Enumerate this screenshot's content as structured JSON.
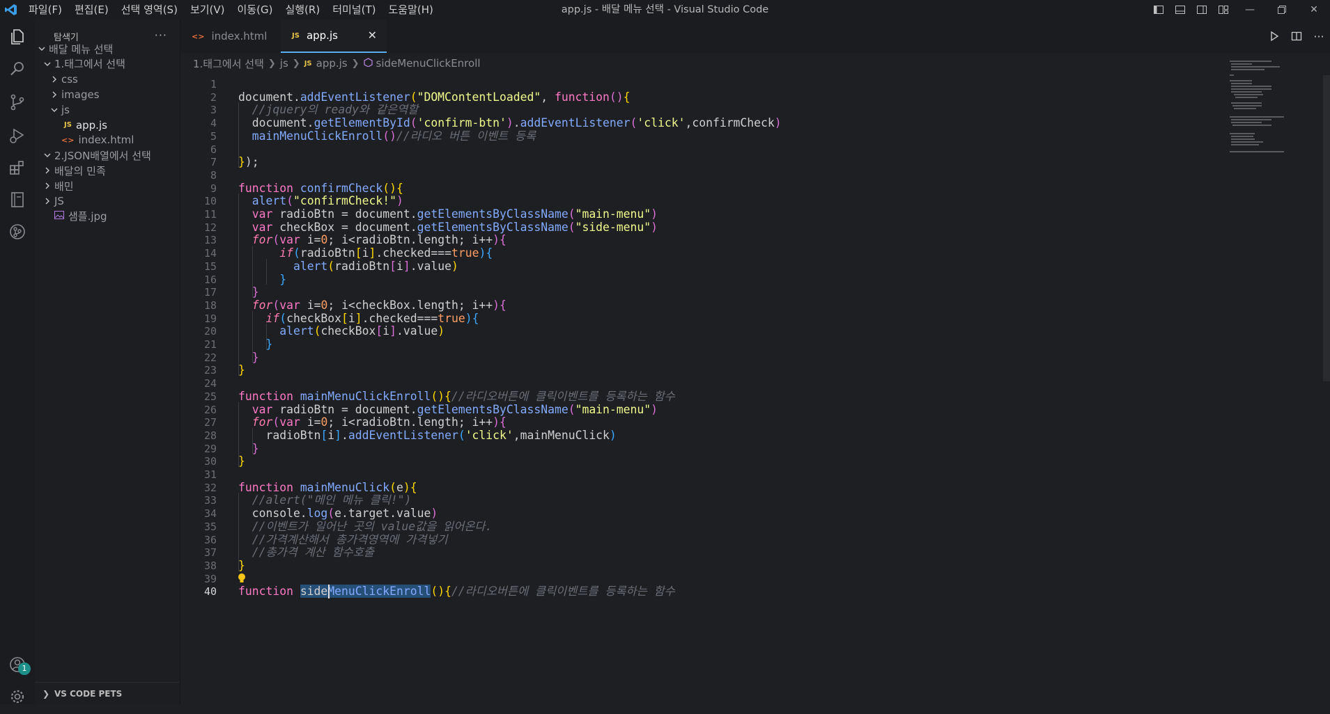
{
  "window": {
    "title": "app.js - 배달 메뉴 선택 - Visual Studio Code"
  },
  "menu": [
    "파일(F)",
    "편집(E)",
    "선택 영역(S)",
    "보기(V)",
    "이동(G)",
    "실행(R)",
    "터미널(T)",
    "도움말(H)"
  ],
  "activity": {
    "badge": "1"
  },
  "sidebar": {
    "title": "탐색기",
    "tree": [
      {
        "label": "배달 메뉴 선택",
        "depth": 0,
        "chevron": "down",
        "icon": ""
      },
      {
        "label": "1.태그에서 선택",
        "depth": 1,
        "chevron": "down",
        "icon": ""
      },
      {
        "label": "css",
        "depth": 2,
        "chevron": "right",
        "icon": ""
      },
      {
        "label": "images",
        "depth": 2,
        "chevron": "right",
        "icon": ""
      },
      {
        "label": "js",
        "depth": 2,
        "chevron": "down",
        "icon": ""
      },
      {
        "label": "app.js",
        "depth": 3,
        "chevron": "",
        "icon": "JS",
        "active": true
      },
      {
        "label": "index.html",
        "depth": 2,
        "chevron": "",
        "icon": "<>"
      },
      {
        "label": "2.JSON배열에서 선택",
        "depth": 1,
        "chevron": "down",
        "icon": ""
      },
      {
        "label": "배달의 민족",
        "depth": 1,
        "chevron": "right",
        "icon": ""
      },
      {
        "label": "배민",
        "depth": 1,
        "chevron": "right",
        "icon": ""
      },
      {
        "label": "JS",
        "depth": 1,
        "chevron": "right",
        "icon": ""
      },
      {
        "label": "샘플.jpg",
        "depth": 1,
        "chevron": "",
        "icon": "img"
      }
    ],
    "footer": "VS CODE PETS"
  },
  "tabs": [
    {
      "label": "index.html",
      "icon": "<>"
    },
    {
      "label": "app.js",
      "icon": "JS"
    }
  ],
  "breadcrumb": [
    "1.태그에서 선택",
    "js",
    "app.js",
    "sideMenuClickEnroll"
  ],
  "colors": {
    "accent": "#5ab0f5",
    "js_icon": "#e8c547",
    "html_icon": "#e66f3c",
    "img_icon": "#b07be0"
  },
  "code": {
    "current_line": 40,
    "lines": [
      [],
      [
        [
          "v",
          "document."
        ],
        [
          "f",
          "addEventListener"
        ],
        [
          "p1",
          "("
        ],
        [
          "s",
          "\"DOMContentLoaded\""
        ],
        [
          "v",
          ", "
        ],
        [
          "k",
          "function"
        ],
        [
          "p2",
          "()"
        ],
        [
          "p1",
          "{"
        ]
      ],
      [
        [
          "c",
          "  //jquery의 ready와 같은역할"
        ]
      ],
      [
        [
          "v",
          "  document."
        ],
        [
          "f",
          "getElementById"
        ],
        [
          "p2",
          "("
        ],
        [
          "s",
          "'confirm-btn'"
        ],
        [
          "p2",
          ")"
        ],
        [
          "v",
          "."
        ],
        [
          "f",
          "addEventListener"
        ],
        [
          "p2",
          "("
        ],
        [
          "s",
          "'click'"
        ],
        [
          "v",
          ",confirmCheck"
        ],
        [
          "p2",
          ")"
        ]
      ],
      [
        [
          "v",
          "  "
        ],
        [
          "f",
          "mainMenuClickEnroll"
        ],
        [
          "p2",
          "()"
        ],
        [
          "c",
          "//라디오 버튼 이벤트 등록"
        ]
      ],
      [],
      [
        [
          "p1",
          "}"
        ],
        [
          "v",
          ");"
        ]
      ],
      [],
      [
        [
          "k",
          "function "
        ],
        [
          "f",
          "confirmCheck"
        ],
        [
          "p1",
          "(){"
        ]
      ],
      [
        [
          "v",
          "  "
        ],
        [
          "f",
          "alert"
        ],
        [
          "p2",
          "("
        ],
        [
          "s",
          "\"confirmCheck!\""
        ],
        [
          "p2",
          ")"
        ]
      ],
      [
        [
          "k",
          "  var "
        ],
        [
          "v",
          "radioBtn = document."
        ],
        [
          "f",
          "getElementsByClassName"
        ],
        [
          "p2",
          "("
        ],
        [
          "s",
          "\"main-menu\""
        ],
        [
          "p2",
          ")"
        ]
      ],
      [
        [
          "k",
          "  var "
        ],
        [
          "v",
          "checkBox = document."
        ],
        [
          "f",
          "getElementsByClassName"
        ],
        [
          "p2",
          "("
        ],
        [
          "s",
          "\"side-menu\""
        ],
        [
          "p2",
          ")"
        ]
      ],
      [
        [
          "kp",
          "  for"
        ],
        [
          "p2",
          "("
        ],
        [
          "k",
          "var "
        ],
        [
          "v",
          "i="
        ],
        [
          "n",
          "0"
        ],
        [
          "v",
          "; i<radioBtn.length; i++"
        ],
        [
          "p2",
          ")"
        ],
        [
          "p2",
          "{"
        ]
      ],
      [
        [
          "kp",
          "      if"
        ],
        [
          "p3",
          "("
        ],
        [
          "v",
          "radioBtn"
        ],
        [
          "p1",
          "["
        ],
        [
          "v",
          "i"
        ],
        [
          "p1",
          "]"
        ],
        [
          "v",
          ".checked==="
        ],
        [
          "n",
          "true"
        ],
        [
          "p3",
          ")"
        ],
        [
          "p3",
          "{"
        ]
      ],
      [
        [
          "v",
          "        "
        ],
        [
          "f",
          "alert"
        ],
        [
          "p1",
          "("
        ],
        [
          "v",
          "radioBtn"
        ],
        [
          "p2",
          "["
        ],
        [
          "v",
          "i"
        ],
        [
          "p2",
          "]"
        ],
        [
          "v",
          ".value"
        ],
        [
          "p1",
          ")"
        ]
      ],
      [
        [
          "p3",
          "      }"
        ]
      ],
      [
        [
          "p2",
          "  }"
        ]
      ],
      [
        [
          "kp",
          "  for"
        ],
        [
          "p2",
          "("
        ],
        [
          "k",
          "var "
        ],
        [
          "v",
          "i="
        ],
        [
          "n",
          "0"
        ],
        [
          "v",
          "; i<checkBox.length; i++"
        ],
        [
          "p2",
          ")"
        ],
        [
          "p2",
          "{"
        ]
      ],
      [
        [
          "kp",
          "    if"
        ],
        [
          "p3",
          "("
        ],
        [
          "v",
          "checkBox"
        ],
        [
          "p1",
          "["
        ],
        [
          "v",
          "i"
        ],
        [
          "p1",
          "]"
        ],
        [
          "v",
          ".checked==="
        ],
        [
          "n",
          "true"
        ],
        [
          "p3",
          ")"
        ],
        [
          "p3",
          "{"
        ]
      ],
      [
        [
          "v",
          "      "
        ],
        [
          "f",
          "alert"
        ],
        [
          "p1",
          "("
        ],
        [
          "v",
          "checkBox"
        ],
        [
          "p2",
          "["
        ],
        [
          "v",
          "i"
        ],
        [
          "p2",
          "]"
        ],
        [
          "v",
          ".value"
        ],
        [
          "p1",
          ")"
        ]
      ],
      [
        [
          "p3",
          "    }"
        ]
      ],
      [
        [
          "p2",
          "  }"
        ]
      ],
      [
        [
          "p1",
          "}"
        ]
      ],
      [],
      [
        [
          "k",
          "function "
        ],
        [
          "f",
          "mainMenuClickEnroll"
        ],
        [
          "p1",
          "(){"
        ],
        [
          "c",
          "//라디오버튼에 클릭이벤트를 등록하는 함수"
        ]
      ],
      [
        [
          "k",
          "  var "
        ],
        [
          "v",
          "radioBtn = document."
        ],
        [
          "f",
          "getElementsByClassName"
        ],
        [
          "p2",
          "("
        ],
        [
          "s",
          "\"main-menu\""
        ],
        [
          "p2",
          ")"
        ]
      ],
      [
        [
          "kp",
          "  for"
        ],
        [
          "p2",
          "("
        ],
        [
          "k",
          "var "
        ],
        [
          "v",
          "i="
        ],
        [
          "n",
          "0"
        ],
        [
          "v",
          "; i<radioBtn.length; i++"
        ],
        [
          "p2",
          ")"
        ],
        [
          "p2",
          "{"
        ]
      ],
      [
        [
          "v",
          "    radioBtn"
        ],
        [
          "p3",
          "["
        ],
        [
          "v",
          "i"
        ],
        [
          "p3",
          "]"
        ],
        [
          "v",
          "."
        ],
        [
          "f",
          "addEventListener"
        ],
        [
          "p3",
          "("
        ],
        [
          "s",
          "'click'"
        ],
        [
          "v",
          ",mainMenuClick"
        ],
        [
          "p3",
          ")"
        ]
      ],
      [
        [
          "p2",
          "  }"
        ]
      ],
      [
        [
          "p1",
          "}"
        ]
      ],
      [],
      [
        [
          "k",
          "function "
        ],
        [
          "f",
          "mainMenuClick"
        ],
        [
          "p1",
          "("
        ],
        [
          "v",
          "e"
        ],
        [
          "p1",
          ")"
        ],
        [
          "p1",
          "{"
        ]
      ],
      [
        [
          "c",
          "  //alert(\"메인 메뉴 클릭!\")"
        ]
      ],
      [
        [
          "v",
          "  console."
        ],
        [
          "f",
          "log"
        ],
        [
          "p2",
          "("
        ],
        [
          "v",
          "e.target.value"
        ],
        [
          "p2",
          ")"
        ]
      ],
      [
        [
          "c",
          "  //이벤트가 일어난 곳의 value값을 읽어온다."
        ]
      ],
      [
        [
          "c",
          "  //가격계산해서 총가격영역에 가격넣기"
        ]
      ],
      [
        [
          "c",
          "  //총가격 계산 함수호출"
        ]
      ],
      [
        [
          "p1",
          "}"
        ]
      ],
      [],
      [
        [
          "k",
          "function "
        ],
        [
          "hl",
          "side"
        ],
        [
          "f hl",
          "MenuClickEnroll"
        ],
        [
          "p1",
          "(){"
        ],
        [
          "c",
          "//라디오버튼에 클릭이벤트를 등록하는 함수"
        ]
      ]
    ]
  }
}
